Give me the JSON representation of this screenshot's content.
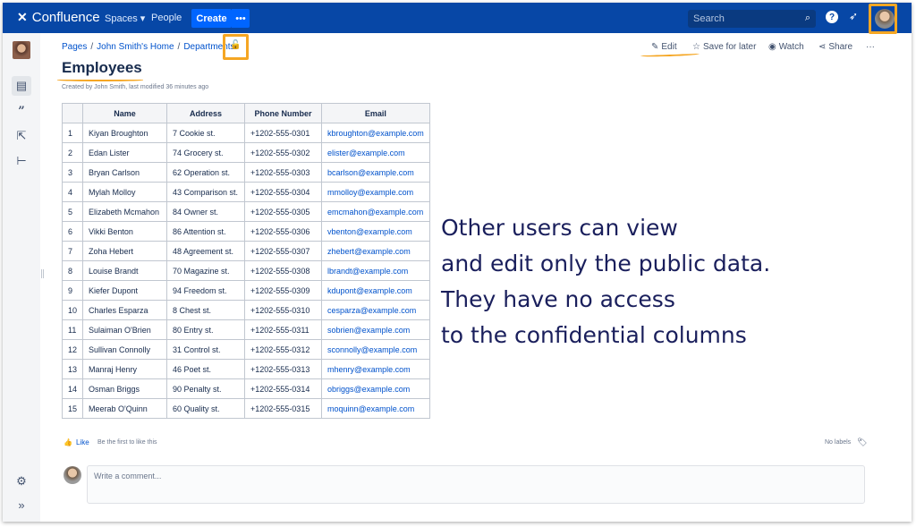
{
  "topbar": {
    "app_name": "Confluence",
    "nav": {
      "spaces": "Spaces ▾",
      "people": "People"
    },
    "create_label": "Create",
    "more_label": "•••",
    "search_placeholder": "Search"
  },
  "breadcrumb": [
    "Pages",
    "/",
    "John Smith's Home",
    "/",
    "Departments"
  ],
  "actions": {
    "edit": "Edit",
    "save_for_later": "Save for later",
    "watch": "Watch",
    "share": "Share",
    "more": "···"
  },
  "page": {
    "title": "Employees",
    "byline": "Created by John Smith, last modified 36 minutes ago"
  },
  "table": {
    "headers": [
      "",
      "Name",
      "Address",
      "Phone Number",
      "Email"
    ],
    "rows": [
      [
        "1",
        "Kiyan Broughton",
        "7 Cookie st.",
        "+1202-555-0301",
        "kbroughton@example.com"
      ],
      [
        "2",
        "Edan Lister",
        "74 Grocery st.",
        "+1202-555-0302",
        "elister@example.com"
      ],
      [
        "3",
        "Bryan Carlson",
        "62 Operation st.",
        "+1202-555-0303",
        "bcarlson@example.com"
      ],
      [
        "4",
        "Mylah Molloy",
        "43 Comparison st.",
        "+1202-555-0304",
        "mmolloy@example.com"
      ],
      [
        "5",
        "Elizabeth Mcmahon",
        "84 Owner st.",
        "+1202-555-0305",
        "emcmahon@example.com"
      ],
      [
        "6",
        "Vikki Benton",
        "86 Attention st.",
        "+1202-555-0306",
        "vbenton@example.com"
      ],
      [
        "7",
        "Zoha Hebert",
        "48 Agreement st.",
        "+1202-555-0307",
        "zhebert@example.com"
      ],
      [
        "8",
        "Louise Brandt",
        "70 Magazine st.",
        "+1202-555-0308",
        "lbrandt@example.com"
      ],
      [
        "9",
        "Kiefer Dupont",
        "94 Freedom st.",
        "+1202-555-0309",
        "kdupont@example.com"
      ],
      [
        "10",
        "Charles Esparza",
        "8 Chest st.",
        "+1202-555-0310",
        "cesparza@example.com"
      ],
      [
        "11",
        "Sulaiman O'Brien",
        "80 Entry st.",
        "+1202-555-0311",
        "sobrien@example.com"
      ],
      [
        "12",
        "Sullivan Connolly",
        "31 Control st.",
        "+1202-555-0312",
        "sconnolly@example.com"
      ],
      [
        "13",
        "Manraj Henry",
        "46 Poet st.",
        "+1202-555-0313",
        "mhenry@example.com"
      ],
      [
        "14",
        "Osman Briggs",
        "90 Penalty st.",
        "+1202-555-0314",
        "obriggs@example.com"
      ],
      [
        "15",
        "Meerab O'Quinn",
        "60 Quality st.",
        "+1202-555-0315",
        "moquinn@example.com"
      ]
    ]
  },
  "overlay": [
    "Other users can view",
    "and edit only the public data.",
    "They have no access",
    "to the confidential columns"
  ],
  "footer": {
    "like": "Like",
    "first_like": "Be the first to like this",
    "labels": "No labels",
    "comment_placeholder": "Write a comment..."
  },
  "colors": {
    "topbar": "#0747a6",
    "accent": "#0065ff",
    "highlight": "#f5a623",
    "link": "#0052cc"
  }
}
